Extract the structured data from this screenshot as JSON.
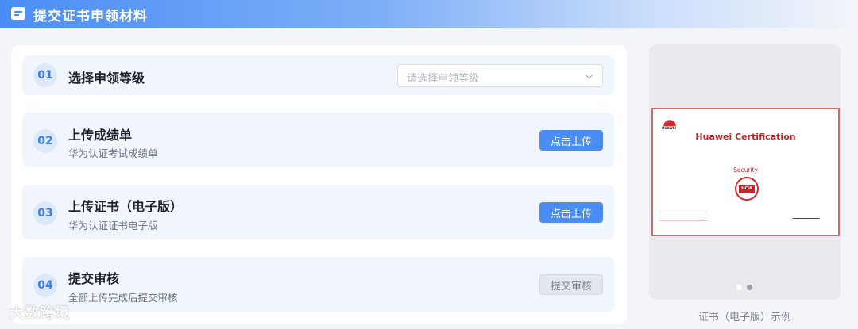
{
  "header": {
    "title": "提交证书申领材料",
    "icon": "document-icon"
  },
  "steps": [
    {
      "number": "01",
      "title": "选择申领等级",
      "subtitle": "",
      "control": {
        "type": "select",
        "placeholder": "请选择申领等级"
      }
    },
    {
      "number": "02",
      "title": "上传成绩单",
      "subtitle": "华为认证考试成绩单",
      "control": {
        "type": "button",
        "label": "点击上传"
      }
    },
    {
      "number": "03",
      "title": "上传证书（电子版）",
      "subtitle": "华为认证证书电子版",
      "control": {
        "type": "button",
        "label": "点击上传"
      }
    },
    {
      "number": "04",
      "title": "提交审核",
      "subtitle": "全部上传完成后提交审核",
      "control": {
        "type": "button",
        "label": "提交审核",
        "disabled": true
      }
    }
  ],
  "preview": {
    "certificate": {
      "brand": "HUAWEI",
      "title": "Huawei Certification",
      "track": "Security",
      "badge": "HCIA"
    },
    "carousel": {
      "count": 2,
      "active": 2
    },
    "caption": "证书（电子版）示例"
  },
  "watermark": "大数跨境",
  "colors": {
    "accent": "#4a8df5",
    "step_bg": "#f1f6fd",
    "cert_red": "#c0282d"
  }
}
